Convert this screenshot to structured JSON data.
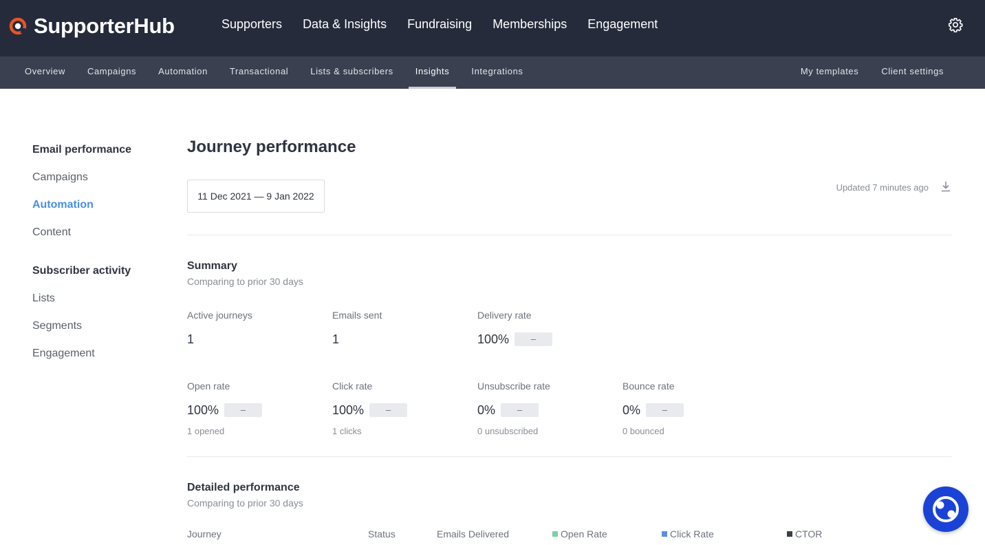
{
  "brand": {
    "name": "SupporterHub",
    "colors": {
      "accent": "#e8542a",
      "active_link": "#4a8fe0",
      "chat": "#1a42d6"
    }
  },
  "main_nav": [
    "Supporters",
    "Data & Insights",
    "Fundraising",
    "Memberships",
    "Engagement"
  ],
  "sub_nav": {
    "left": [
      "Overview",
      "Campaigns",
      "Automation",
      "Transactional",
      "Lists & subscribers",
      "Insights",
      "Integrations"
    ],
    "right": [
      "My templates",
      "Client settings"
    ],
    "active": "Insights"
  },
  "sidebar": {
    "email_heading": "Email performance",
    "email_items": [
      "Campaigns",
      "Automation",
      "Content"
    ],
    "active": "Automation",
    "subscriber_heading": "Subscriber activity",
    "subscriber_items": [
      "Lists",
      "Segments",
      "Engagement"
    ]
  },
  "page": {
    "title": "Journey performance",
    "date_range": "11 Dec 2021 — 9 Jan 2022",
    "updated": "Updated 7 minutes ago"
  },
  "summary": {
    "title": "Summary",
    "subtitle": "Comparing to prior 30 days",
    "row1": [
      {
        "label": "Active journeys",
        "value": "1"
      },
      {
        "label": "Emails sent",
        "value": "1"
      },
      {
        "label": "Delivery rate",
        "value": "100%",
        "change": "–"
      }
    ],
    "row2": [
      {
        "label": "Open rate",
        "value": "100%",
        "change": "–",
        "sub": "1 opened"
      },
      {
        "label": "Click rate",
        "value": "100%",
        "change": "–",
        "sub": "1 clicks"
      },
      {
        "label": "Unsubscribe rate",
        "value": "0%",
        "change": "–",
        "sub": "0 unsubscribed"
      },
      {
        "label": "Bounce rate",
        "value": "0%",
        "change": "–",
        "sub": "0 bounced"
      }
    ]
  },
  "detailed": {
    "title": "Detailed performance",
    "subtitle": "Comparing to prior 30 days",
    "columns": [
      "Journey",
      "Status",
      "Emails Delivered",
      "Open Rate",
      "Click Rate",
      "CTOR"
    ],
    "legend_colors": {
      "Open Rate": "#7fd0a2",
      "Click Rate": "#5b8ee6",
      "CTOR": "#3a3f4a"
    }
  }
}
